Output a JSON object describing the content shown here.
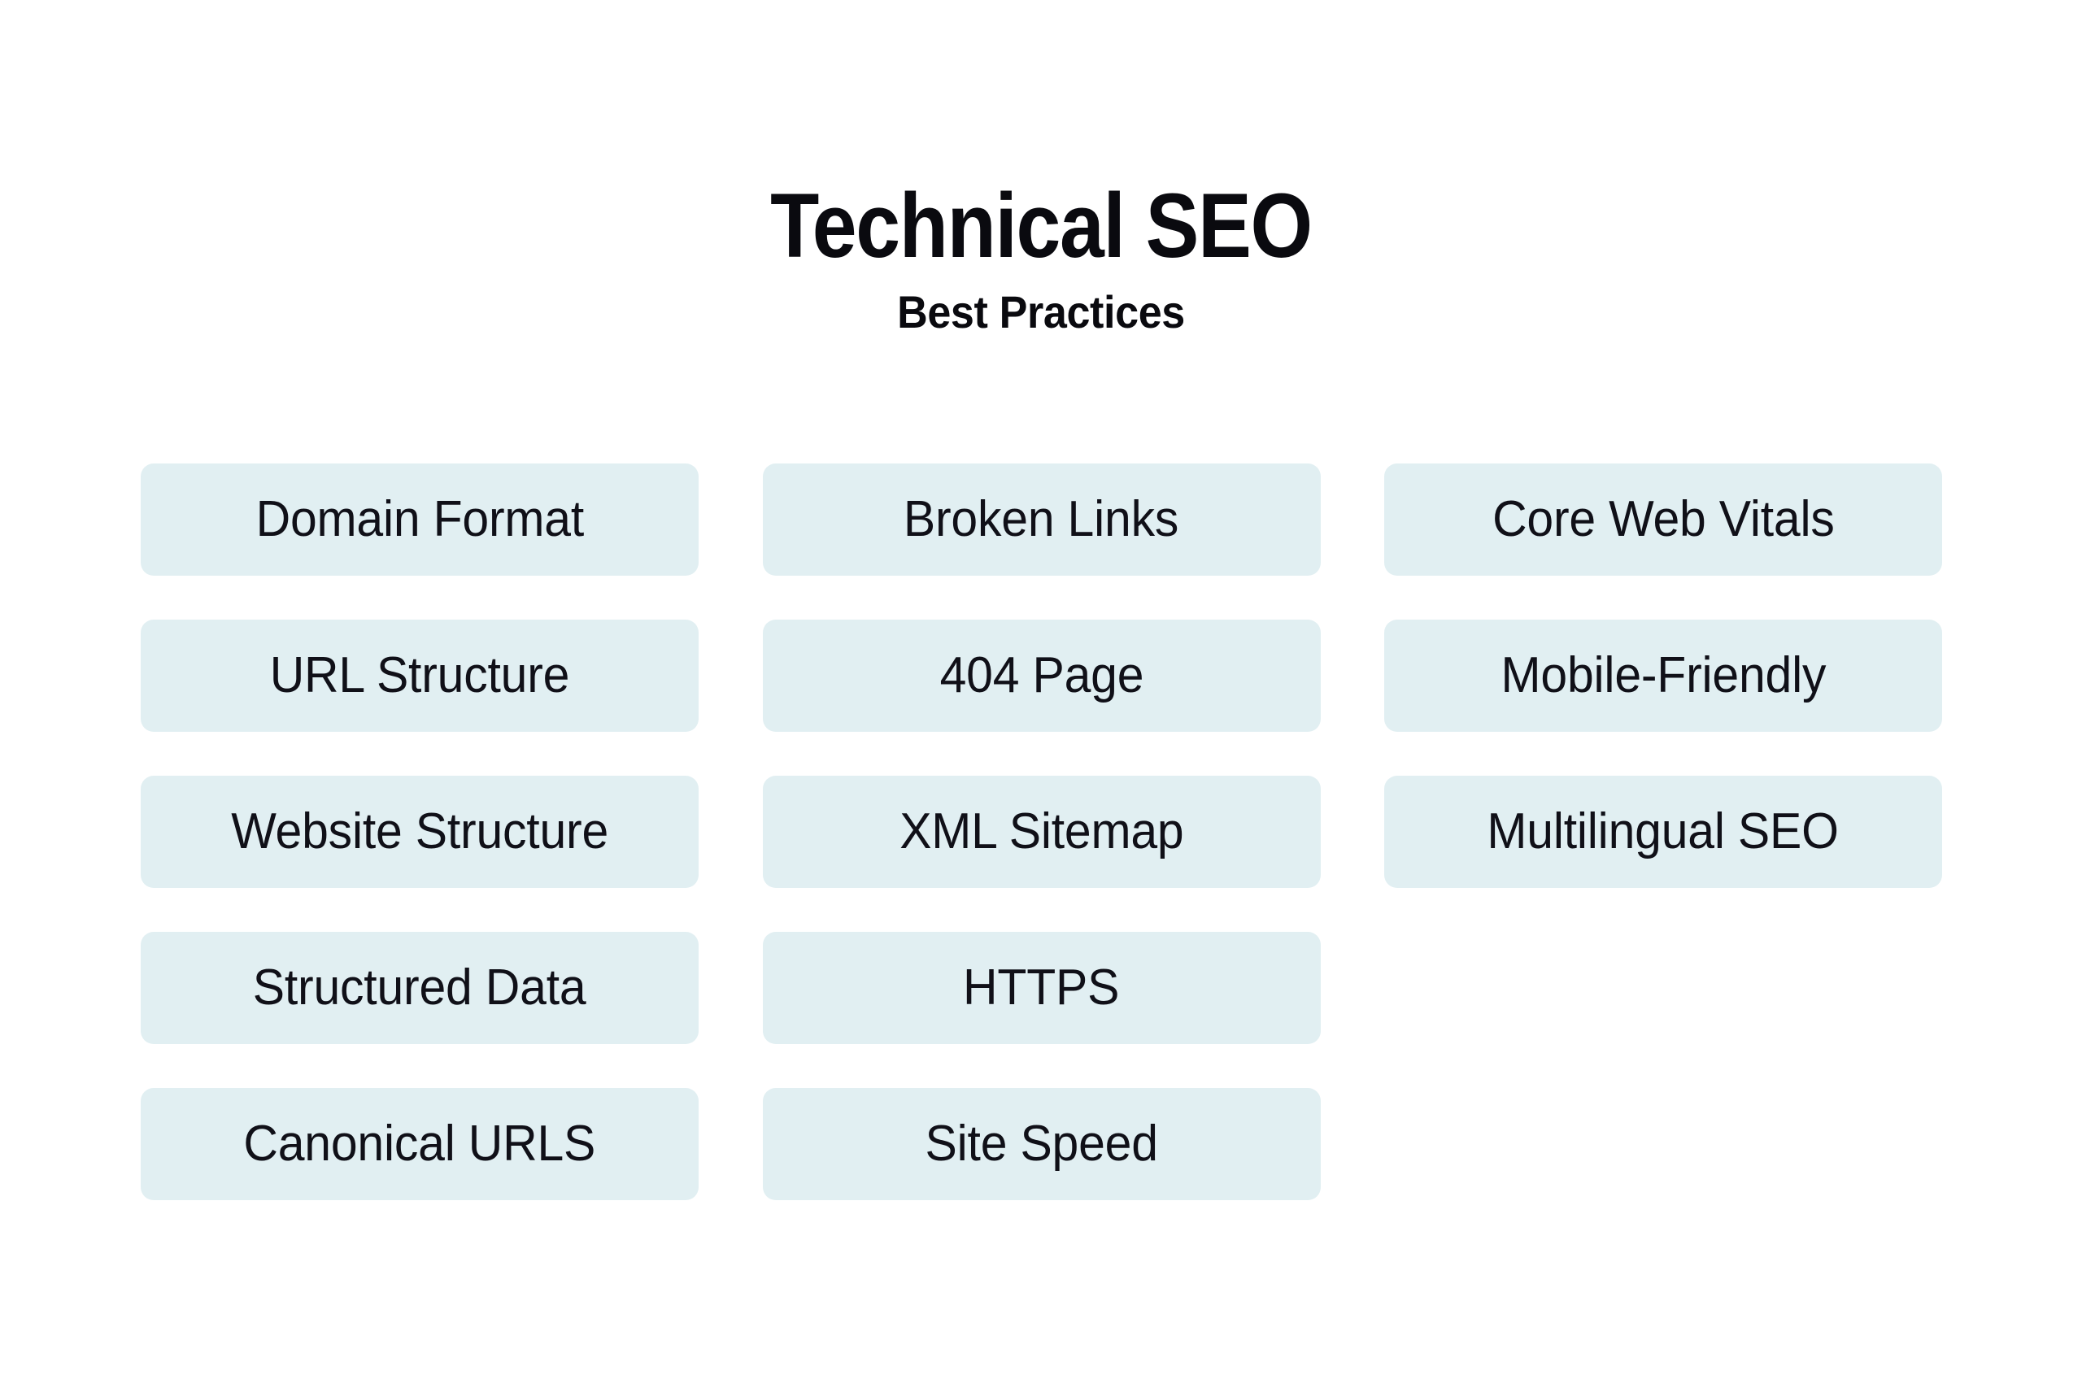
{
  "header": {
    "title": "Technical SEO",
    "subtitle": "Best Practices"
  },
  "theme": {
    "background": "#ffffff",
    "pill_background": "#e1eff2",
    "text_color": "#101018",
    "title_color": "#0a0a0f"
  },
  "columns": [
    {
      "name": "column-1",
      "items": [
        {
          "label": "Domain Format"
        },
        {
          "label": "URL Structure"
        },
        {
          "label": "Website Structure"
        },
        {
          "label": "Structured Data"
        },
        {
          "label": "Canonical URLS"
        }
      ]
    },
    {
      "name": "column-2",
      "items": [
        {
          "label": "Broken Links"
        },
        {
          "label": "404 Page"
        },
        {
          "label": "XML Sitemap"
        },
        {
          "label": "HTTPS"
        },
        {
          "label": "Site Speed"
        }
      ]
    },
    {
      "name": "column-3",
      "items": [
        {
          "label": "Core Web Vitals"
        },
        {
          "label": "Mobile-Friendly"
        },
        {
          "label": "Multilingual SEO"
        }
      ]
    }
  ]
}
